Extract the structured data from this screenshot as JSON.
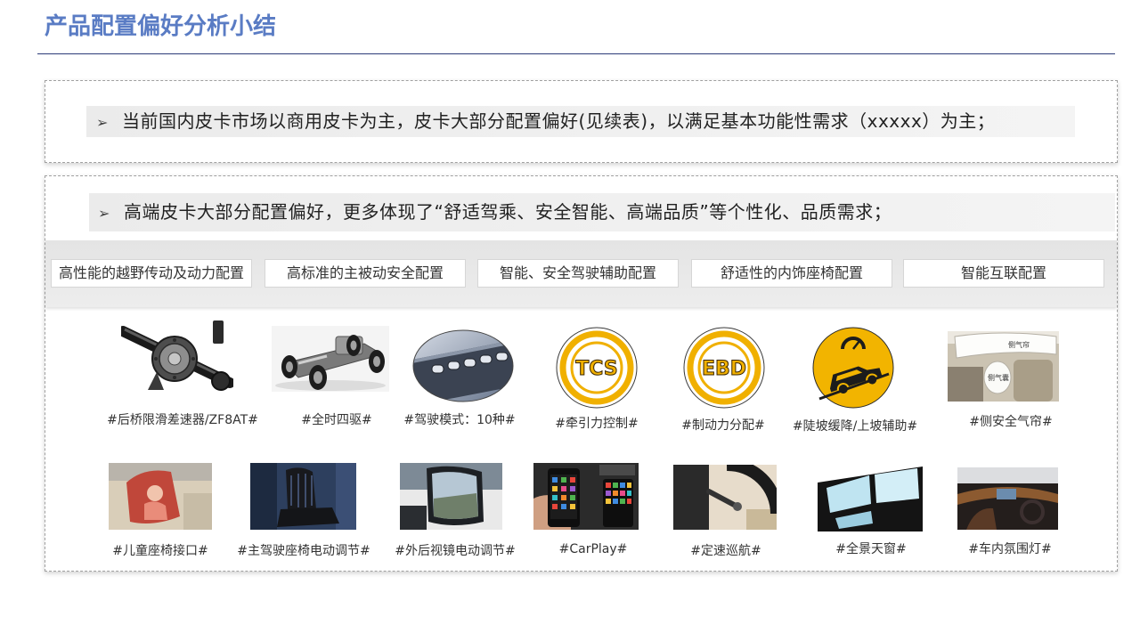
{
  "title": "产品配置偏好分析小结",
  "summary": {
    "bullet": "➢",
    "text": "当前国内皮卡市场以商用皮卡为主，皮卡大部分配置偏好(见续表)，以满足基本功能性需求（xxxxx）为主；"
  },
  "premium": {
    "bullet": "➢",
    "text": "高端皮卡大部分配置偏好，更多体现了“舒适驾乘、安全智能、高端品质”等个性化、品质需求；",
    "categories": [
      "高性能的越野传动及动力配置",
      "高标准的主被动安全配置",
      "智能、安全驾驶辅助配置",
      "舒适性的内饰座椅配置",
      "智能互联配置"
    ]
  },
  "features": {
    "row1": [
      {
        "label": "#后桥限滑差速器/ZF8AT#",
        "image": "rear-axle-differential-photo"
      },
      {
        "label": "#全时四驱#",
        "image": "4wd-chassis-photo"
      },
      {
        "label": "#驾驶模式：10种#",
        "image": "drive-mode-buttons-photo"
      },
      {
        "label": "#牵引力控制#",
        "image": "tcs-badge-icon",
        "badge": "TCS"
      },
      {
        "label": "#制动力分配#",
        "image": "ebd-badge-icon",
        "badge": "EBD"
      },
      {
        "label": "#陡坡缓降/上坡辅助#",
        "image": "hill-descent-icon"
      },
      {
        "label": "#侧安全气帘#",
        "image": "side-airbag-photo",
        "tags": [
          "侧气帘",
          "侧气囊"
        ]
      }
    ],
    "row2": [
      {
        "label": "#儿童座椅接口#",
        "image": "child-seat-photo"
      },
      {
        "label": "#主驾驶座椅电动调节#",
        "image": "driver-seat-photo"
      },
      {
        "label": "#外后视镜电动调节#",
        "image": "side-mirror-photo"
      },
      {
        "label": "#CarPlay#",
        "image": "carplay-phone-photo"
      },
      {
        "label": "#定速巡航#",
        "image": "cruise-control-stalk-photo"
      },
      {
        "label": "#全景天窗#",
        "image": "panoramic-sunroof-photo"
      },
      {
        "label": "#车内氛围灯#",
        "image": "interior-dashboard-photo"
      }
    ]
  },
  "colors": {
    "title": "#5a7cc4",
    "rule": "#2c3b78",
    "panel_border": "#a0a0a0",
    "badge_yellow": "#f0b000"
  }
}
